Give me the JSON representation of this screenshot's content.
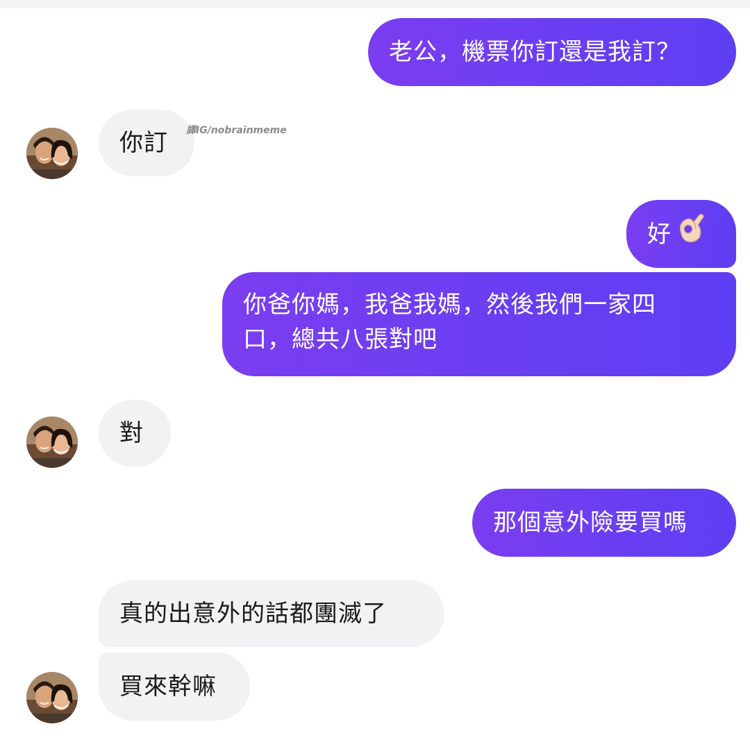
{
  "watermark": "譯IG/nobrainmeme",
  "messages": [
    {
      "side": "out",
      "text": "老公，機票你訂還是我訂？"
    },
    {
      "side": "in",
      "text": "你訂"
    },
    {
      "side": "out",
      "text": "好",
      "emoji": "ok-hand-icon"
    },
    {
      "side": "out",
      "lines": [
        "你爸你媽，我爸我媽，然後我們一家四",
        "口，總共八張對吧"
      ]
    },
    {
      "side": "in",
      "text": "對"
    },
    {
      "side": "out",
      "text": "那個意外險要買嗎"
    },
    {
      "side": "in",
      "text": "真的出意外的話都團滅了"
    },
    {
      "side": "in",
      "text": "買來幹嘛"
    }
  ],
  "colors": {
    "outgoing_bubble": "#6a3ef2",
    "incoming_bubble": "#f2f2f5",
    "outgoing_text": "#ffffff",
    "incoming_text": "#1a1a1a"
  }
}
